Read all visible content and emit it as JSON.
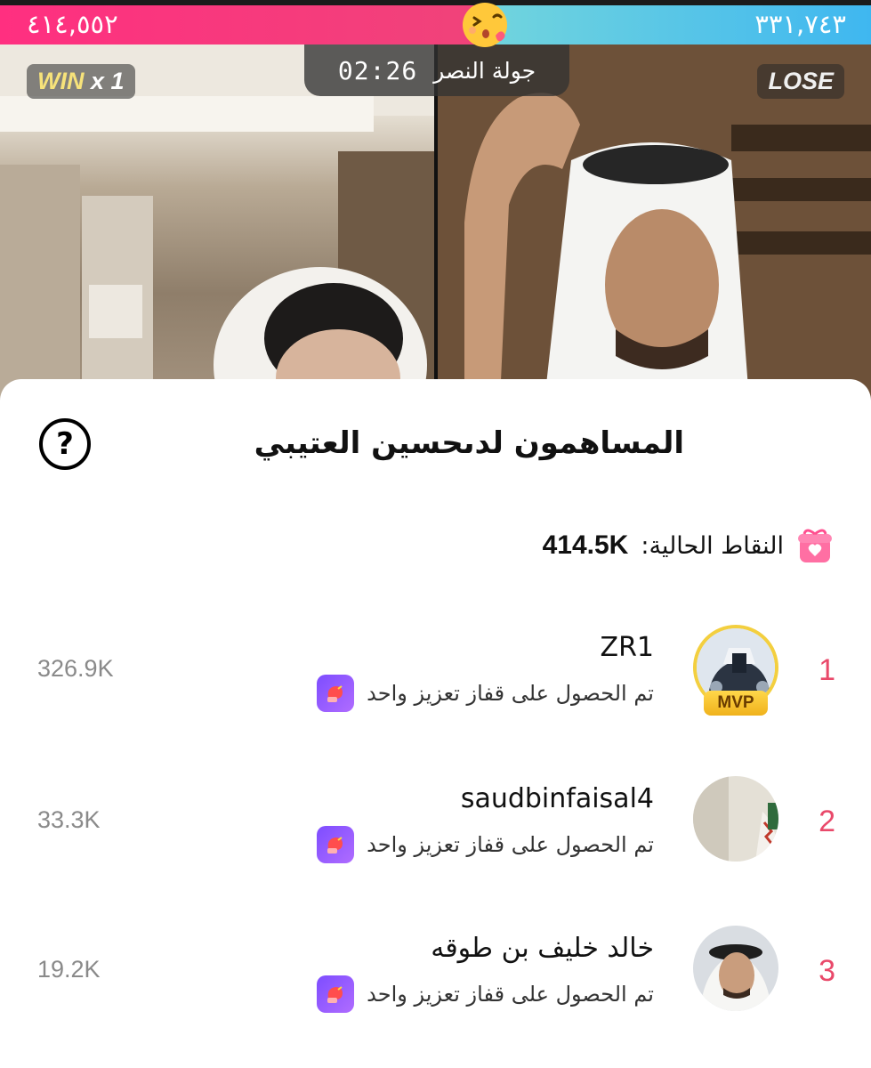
{
  "battle": {
    "left_score": "٤١٤,٥٥٢",
    "right_score": "٣٣١,٧٤٣",
    "round_label": "جولة النصر",
    "timer": "02:26",
    "win_word": "WIN",
    "win_multiplier": "x 1",
    "lose_label": "LOSE",
    "left_color": "#f0437a",
    "right_color": "#3fb7f0"
  },
  "sheet": {
    "title": "المساهمون لدىحسين العتيبي",
    "help_icon": "question-mark-icon",
    "points_label": "النقاط الحالية:",
    "points_value": "414.5K",
    "points_icon": "gift-box-icon"
  },
  "contributors": [
    {
      "rank": "1",
      "name": "ZR1",
      "boost_text": "تم الحصول على قفاز تعزيز واحد",
      "score": "326.9K",
      "badge": "MVP"
    },
    {
      "rank": "2",
      "name": "saudbinfaisal4",
      "boost_text": "تم الحصول على قفاز تعزيز واحد",
      "score": "33.3K"
    },
    {
      "rank": "3",
      "name": "خالد خليف بن طوقه",
      "boost_text": "تم الحصول على قفاز تعزيز واحد",
      "score": "19.2K"
    }
  ],
  "colors": {
    "rank": "#e9496a",
    "mvp_gold": "#f3cf3f",
    "boost_purple": "#7d4dff"
  }
}
